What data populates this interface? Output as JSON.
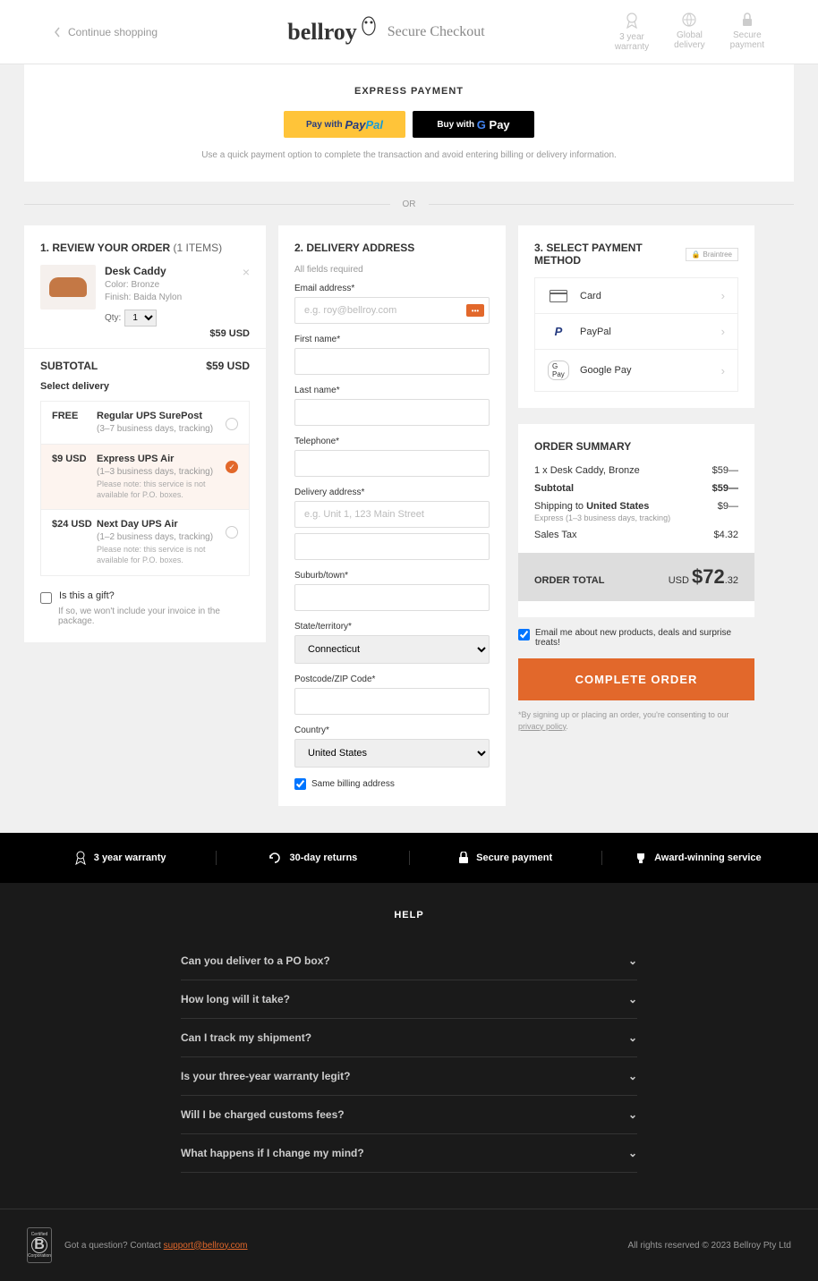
{
  "header": {
    "back": "Continue shopping",
    "brand": "bellroy",
    "tagline": "Secure Checkout",
    "trust": [
      {
        "l1": "3 year",
        "l2": "warranty"
      },
      {
        "l1": "Global",
        "l2": "delivery"
      },
      {
        "l1": "Secure",
        "l2": "payment"
      }
    ]
  },
  "express": {
    "title": "EXPRESS PAYMENT",
    "paypal_pre": "Pay with",
    "paypal_brand": "PayPal",
    "gpay_pre": "Buy with",
    "gpay_brand": "G Pay",
    "hint": "Use a quick payment option to complete the transaction and avoid entering billing or delivery information.",
    "or": "OR"
  },
  "review": {
    "title": "1. REVIEW YOUR ORDER",
    "items_count": "(1 ITEMS)",
    "prod": {
      "name": "Desk Caddy",
      "color_label": "Color:",
      "color": "Bronze",
      "finish_label": "Finish:",
      "finish": "Baida Nylon",
      "qty_label": "Qty:",
      "qty": "1",
      "price": "$59 USD"
    },
    "subtotal_label": "SUBTOTAL",
    "subtotal": "$59 USD",
    "delivery_label": "Select delivery",
    "ship": [
      {
        "price": "FREE",
        "name": "Regular UPS SurePost",
        "det": "(3–7 business days, tracking)",
        "note": "",
        "sel": false
      },
      {
        "price": "$9 USD",
        "name": "Express UPS Air",
        "det": "(1–3 business days, tracking)",
        "note": "Please note: this service is not available for P.O. boxes.",
        "sel": true
      },
      {
        "price": "$24 USD",
        "name": "Next Day UPS Air",
        "det": "(1–2 business days, tracking)",
        "note": "Please note: this service is not available for P.O. boxes.",
        "sel": false
      }
    ],
    "gift_label": "Is this a gift?",
    "gift_hint": "If so, we won't include your invoice in the package."
  },
  "delivery": {
    "title": "2. DELIVERY ADDRESS",
    "req": "All fields required",
    "email_label": "Email address",
    "email_ph": "e.g. roy@bellroy.com",
    "fname_label": "First name",
    "lname_label": "Last name",
    "tel_label": "Telephone",
    "addr_label": "Delivery address",
    "addr_ph": "e.g. Unit 1, 123 Main Street",
    "suburb_label": "Suburb/town",
    "state_label": "State/territory",
    "state": "Connecticut",
    "zip_label": "Postcode/ZIP Code",
    "country_label": "Country",
    "country": "United States",
    "same_billing": "Same billing address"
  },
  "payment": {
    "title": "3. SELECT PAYMENT METHOD",
    "provider": "Braintree",
    "methods": [
      "Card",
      "PayPal",
      "Google Pay"
    ]
  },
  "summary": {
    "title": "ORDER SUMMARY",
    "line1_label": "1 x Desk Caddy, Bronze",
    "line1_val": "$59—",
    "sub_label": "Subtotal",
    "sub_val": "$59—",
    "ship_label": "Shipping to",
    "ship_country": "United States",
    "ship_val": "$9—",
    "ship_det": "Express (1–3 business days, tracking)",
    "tax_label": "Sales Tax",
    "tax_val": "$4.32",
    "total_label": "ORDER TOTAL",
    "total_curr": "USD",
    "total_main": "$72",
    "total_cents": ".32",
    "email_me": "Email me about new products, deals and surprise treats!",
    "complete": "COMPLETE ORDER",
    "consent_pre": "*By signing up or placing an order, you're consenting to our ",
    "consent_link": "privacy policy",
    "consent_post": "."
  },
  "footer_items": [
    "3 year warranty",
    "30-day returns",
    "Secure payment",
    "Award-winning service"
  ],
  "help": {
    "title": "HELP",
    "faqs": [
      "Can you deliver to a PO box?",
      "How long will it take?",
      "Can I track my shipment?",
      "Is your three-year warranty legit?",
      "Will I be charged customs fees?",
      "What happens if I change my mind?"
    ]
  },
  "bottom": {
    "question": "Got a question? Contact ",
    "support": "support@bellroy.com",
    "rights": "All rights reserved © 2023 Bellroy Pty Ltd"
  }
}
